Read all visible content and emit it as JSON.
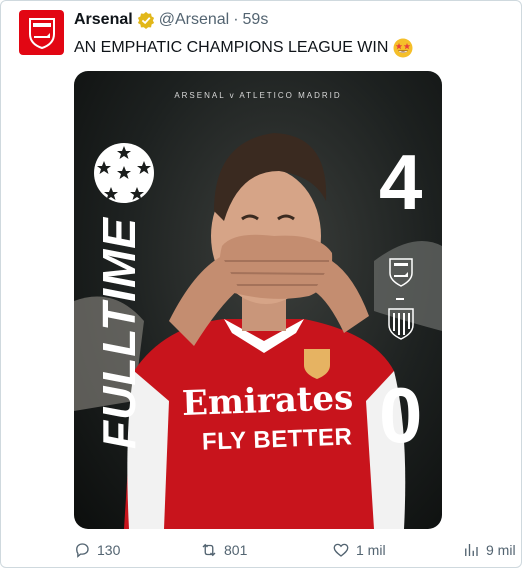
{
  "tweet": {
    "author_name": "Arsenal",
    "handle": "@Arsenal",
    "separator": "·",
    "time": "59s",
    "text": "AN EMPHATIC CHAMPIONS LEAGUE WIN"
  },
  "graphic": {
    "match_line": "ARSENAL v ATLETICO MADRID",
    "full_time": "FULLTIME",
    "home_score": "4",
    "away_score": "0",
    "shirt_sponsor": "Emirates",
    "shirt_tagline": "FLY BETTER"
  },
  "actions": {
    "replies": "130",
    "reposts": "801",
    "likes": "1 mil",
    "views": "9 mil"
  },
  "icons": [
    "verified-badge-icon",
    "star-struck-emoji-icon",
    "champions-league-starball-icon",
    "arsenal-crest-icon",
    "atletico-crest-icon",
    "reply-icon",
    "repost-icon",
    "like-icon",
    "views-icon"
  ],
  "colors": {
    "brand_red": "#e20613",
    "verified_gold": "#e2b719",
    "muted": "#536471"
  }
}
